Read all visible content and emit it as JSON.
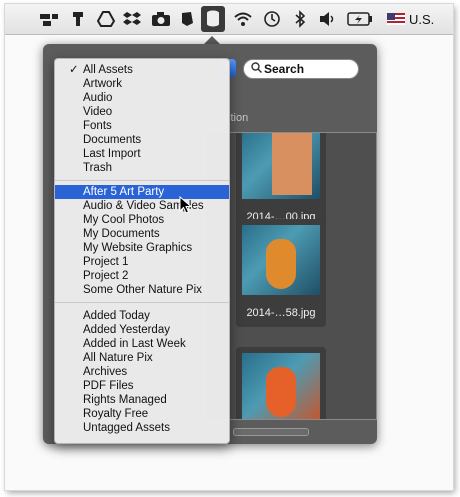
{
  "menubar": {
    "icons": [
      "menubar-app-icon",
      "hammer-icon",
      "drive-icon",
      "dropbox-icon",
      "camera-icon",
      "evernote-icon",
      "database-icon",
      "wifi-icon",
      "time-machine-icon",
      "bluetooth-icon",
      "volume-icon",
      "battery-icon",
      "us-flag-icon"
    ],
    "input_source": "U.S."
  },
  "search": {
    "placeholder": "Search"
  },
  "section_label": "ction",
  "thumbnails": [
    {
      "caption": "2014-…00.jpg"
    },
    {
      "caption": "2014-…58.jpg"
    },
    {
      "caption": ""
    }
  ],
  "menu": {
    "group1": [
      "All Assets",
      "Artwork",
      "Audio",
      "Video",
      "Fonts",
      "Documents",
      "Last Import",
      "Trash"
    ],
    "checked": "All Assets",
    "group2": [
      "After 5 Art Party",
      "Audio & Video Samples",
      "My Cool Photos",
      "My Documents",
      "My Website Graphics",
      "Project 1",
      "Project 2",
      "Some Other Nature Pix"
    ],
    "highlighted": "After 5 Art Party",
    "group3": [
      "Added Today",
      "Added Yesterday",
      "Added in Last Week",
      "All Nature Pix",
      "Archives",
      "PDF Files",
      "Rights Managed",
      "Royalty Free",
      "Untagged Assets"
    ]
  }
}
